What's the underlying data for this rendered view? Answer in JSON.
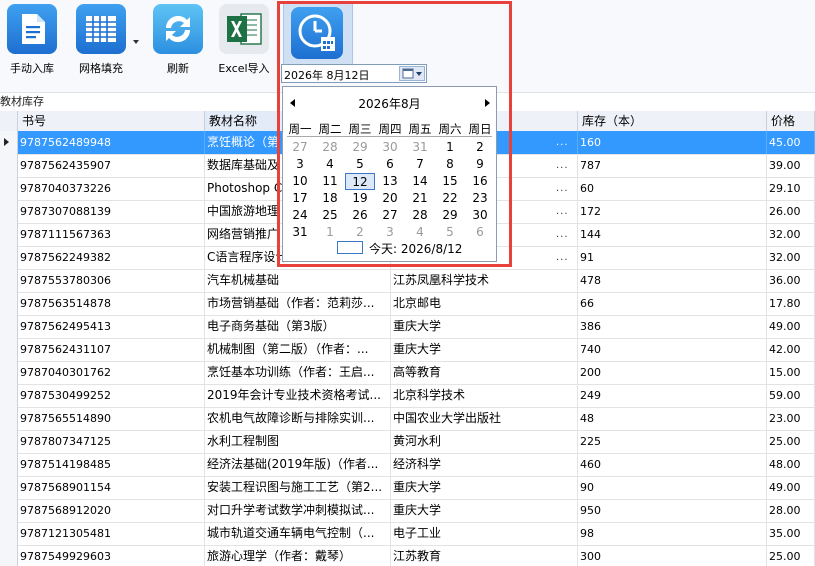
{
  "toolbar": {
    "buttons": [
      {
        "label": "手动入库",
        "icon": "document-icon"
      },
      {
        "label": "网格填充",
        "icon": "grid-icon"
      },
      {
        "label": "刷新",
        "icon": "refresh-icon"
      },
      {
        "label": "Excel导入",
        "icon": "excel-icon"
      },
      {
        "label": "",
        "icon": "calendar-clock-icon"
      }
    ]
  },
  "section_label": "教材库存",
  "date_field": {
    "value": "2026年  8月12日"
  },
  "calendar": {
    "title": "2026年8月",
    "weekdays": [
      "周一",
      "周二",
      "周三",
      "周四",
      "周五",
      "周六",
      "周日"
    ],
    "weeks": [
      [
        "27",
        "28",
        "29",
        "30",
        "31",
        "1",
        "2"
      ],
      [
        "3",
        "4",
        "5",
        "6",
        "7",
        "8",
        "9"
      ],
      [
        "10",
        "11",
        "12",
        "13",
        "14",
        "15",
        "16"
      ],
      [
        "17",
        "18",
        "19",
        "20",
        "21",
        "22",
        "23"
      ],
      [
        "24",
        "25",
        "26",
        "27",
        "28",
        "29",
        "30"
      ],
      [
        "31",
        "1",
        "2",
        "3",
        "4",
        "5",
        "6"
      ]
    ],
    "selected": "12",
    "today_label": "今天: 2026/8/12"
  },
  "table": {
    "headers": [
      "书号",
      "教材名称",
      "",
      "库存（本）",
      "价格"
    ],
    "rows": [
      [
        "9787562489948",
        "烹饪概论（第",
        "",
        "160",
        "45.00"
      ],
      [
        "9787562435907",
        "数据库基础及",
        "",
        "787",
        "39.00"
      ],
      [
        "9787040373226",
        "Photoshop CS",
        "",
        "60",
        "29.10"
      ],
      [
        "9787307088139",
        "中国旅游地理",
        "",
        "172",
        "26.00"
      ],
      [
        "9787111567363",
        "网络营销推广",
        "",
        "144",
        "32.00"
      ],
      [
        "9787562249382",
        "C语言程序设计",
        "",
        "91",
        "32.00"
      ],
      [
        "9787553780306",
        "汽车机械基础",
        "江苏凤凰科学技术",
        "478",
        "36.00"
      ],
      [
        "9787563514878",
        "市场营销基础（作者：范莉莎...",
        "北京邮电",
        "66",
        "17.80"
      ],
      [
        "9787562495413",
        "电子商务基础（第3版）",
        "重庆大学",
        "386",
        "49.00"
      ],
      [
        "9787562431107",
        "机械制图（第二版）（作者：...",
        "重庆大学",
        "740",
        "42.00"
      ],
      [
        "9787040301762",
        "烹饪基本功训练（作者：王启...",
        "高等教育",
        "200",
        "15.00"
      ],
      [
        "9787530499252",
        "2019年会计专业技术资格考试...",
        "北京科学技术",
        "249",
        "59.00"
      ],
      [
        "9787565514890",
        "农机电气故障诊断与排除实训...",
        "中国农业大学出版社",
        "48",
        "23.00"
      ],
      [
        "9787807347125",
        "水利工程制图",
        "黄河水利",
        "225",
        "25.00"
      ],
      [
        "9787514198485",
        "经济法基础(2019年版)（作者...",
        "经济科学",
        "460",
        "48.00"
      ],
      [
        "9787568901154",
        "安装工程识图与施工工艺（第2...",
        "重庆大学",
        "90",
        "49.00"
      ],
      [
        "9787568912020",
        "对口升学考试数学冲刺模拟试...",
        "重庆大学",
        "950",
        "28.00"
      ],
      [
        "9787121305481",
        "城市轨道交通车辆电气控制（...",
        "电子工业",
        "98",
        "35.00"
      ],
      [
        "9787549929603",
        "旅游心理学（作者：戴琴）",
        "江苏教育",
        "300",
        "25.00"
      ]
    ]
  }
}
